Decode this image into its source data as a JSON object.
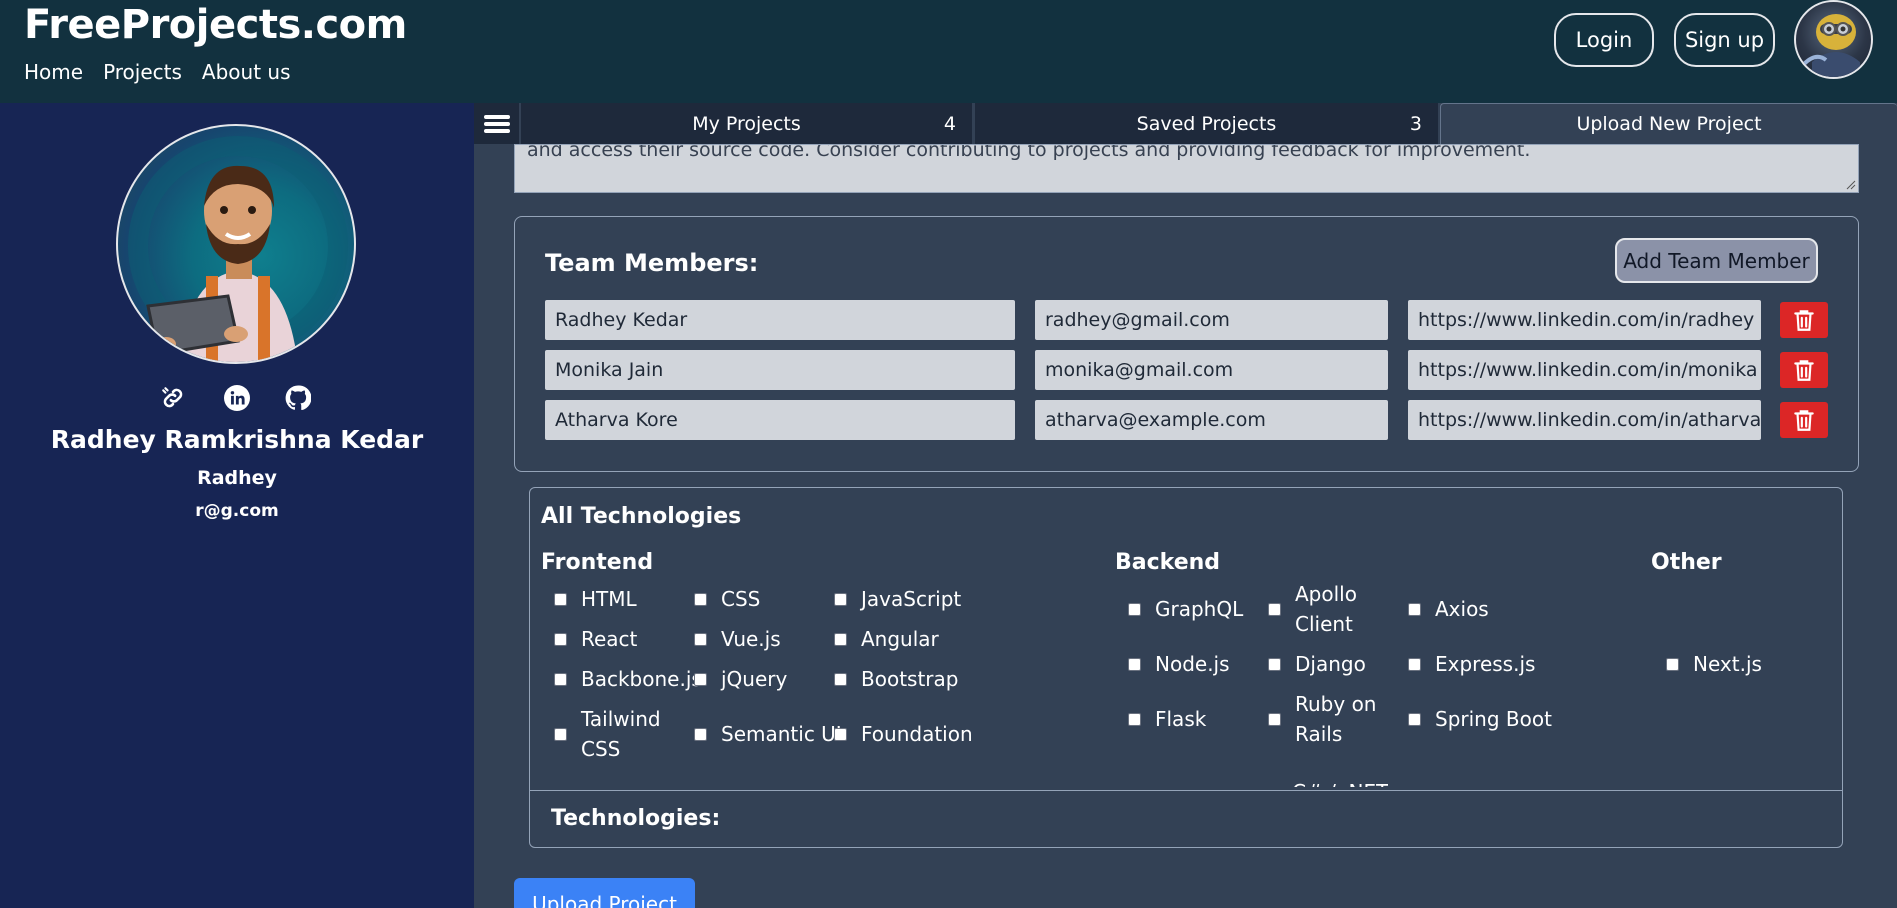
{
  "header": {
    "brand": "FreeProjects.com",
    "nav": [
      "Home",
      "Projects",
      "About us"
    ],
    "login_label": "Login",
    "signup_label": "Sign up"
  },
  "profile": {
    "name": "Radhey Ramkrishna Kedar",
    "username": "Radhey",
    "email": "r@g.com",
    "social_icons": [
      "link-icon",
      "linkedin-icon",
      "github-icon"
    ]
  },
  "tabs": [
    {
      "label": "My Projects",
      "count": "4"
    },
    {
      "label": "Saved Projects",
      "count": "3"
    },
    {
      "label": "Upload New Project",
      "count": ""
    }
  ],
  "description": {
    "visible_text": "and access their source code. Consider contributing to projects and providing feedback for improvement."
  },
  "team": {
    "title": "Team Members:",
    "add_label": "Add Team Member",
    "members": [
      {
        "name": "Radhey Kedar",
        "email": "radhey@gmail.com",
        "linkedin": "https://www.linkedin.com/in/radhey"
      },
      {
        "name": "Monika Jain",
        "email": "monika@gmail.com",
        "linkedin": "https://www.linkedin.com/in/monika"
      },
      {
        "name": "Atharva Kore",
        "email": "atharva@example.com",
        "linkedin": "https://www.linkedin.com/in/atharva"
      }
    ]
  },
  "technologies": {
    "title": "All Technologies",
    "selected_label": "Technologies:",
    "frontend": {
      "label": "Frontend",
      "items": [
        "HTML",
        "CSS",
        "JavaScript",
        "React",
        "Vue.js",
        "Angular",
        "Backbone.js",
        "jQuery",
        "Bootstrap",
        "Tailwind CSS",
        "Semantic UI",
        "Foundation"
      ]
    },
    "backend": {
      "label": "Backend",
      "items": [
        "GraphQL",
        "Apollo Client",
        "Axios",
        "Node.js",
        "Django",
        "Express.js",
        "Flask",
        "Ruby on Rails",
        "Spring Boot"
      ],
      "partial_item": "C# / .NET"
    },
    "other": {
      "label": "Other",
      "items": [
        "Next.js"
      ]
    }
  },
  "upload_label": "Upload Project",
  "colors": {
    "header_bg": "#12313f",
    "sidebar_bg": "#172554",
    "main_bg": "#334155",
    "delete_red": "#dc2626",
    "upload_blue": "#3b82f6"
  }
}
